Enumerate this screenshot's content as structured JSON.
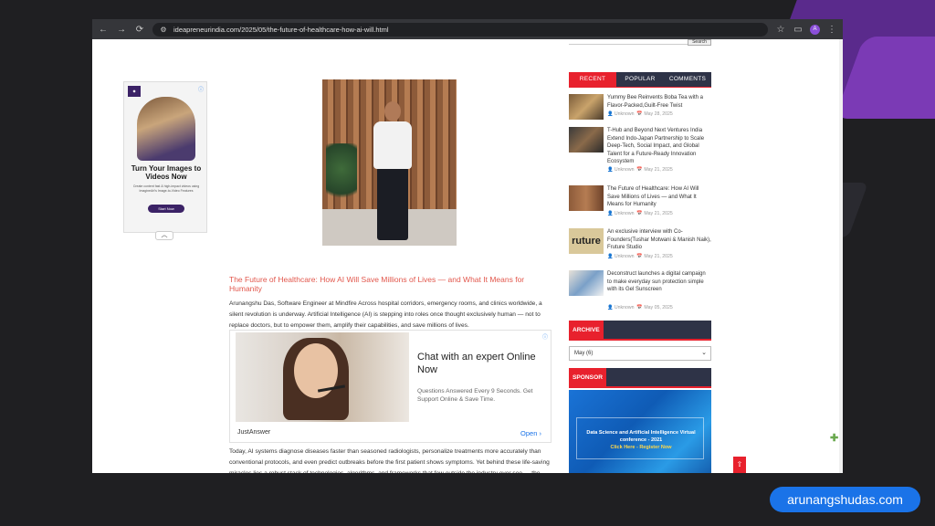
{
  "browser": {
    "url": "ideapreneurindia.com/2025/05/the-future-of-healthcare-how-ai-will.html",
    "profile_initial": "A"
  },
  "side_ad": {
    "headline": "Turn Your Images to Videos Now",
    "subtext": "Create content fast & high-impact videos using ImagineArt's Image-to-Video Features",
    "button": "Start Now"
  },
  "article": {
    "title": "The Future of Healthcare: How AI Will Save Millions of Lives — and What It Means for Humanity",
    "paragraph1": "Arunangshu Das, Software Engineer at Mindfire Across hospital corridors, emergency rooms, and clinics worldwide, a silent revolution is underway. Artificial Intelligence (AI) is stepping into roles once thought exclusively human — not to replace doctors, but to empower them, amplify their capabilities, and save millions of lives.",
    "paragraph2": "Today, AI systems diagnose diseases faster than seasoned radiologists, personalize treatments more accurately than conventional protocols, and even predict outbreaks before the first patient shows symptoms. Yet behind these life-saving miracles lies a robust stack of technologies, algorithms, and frameworks that few outside the industry ever see — the unsung heroes of a new medical era."
  },
  "inline_ad": {
    "headline": "Chat with an expert Online Now",
    "subtext": "Questions Answered Every 9 Seconds. Get Support Online & Save Time.",
    "brand": "JustAnswer",
    "cta": "Open"
  },
  "sidebar": {
    "search_button": "Search",
    "tabs": [
      "RECENT",
      "POPULAR",
      "COMMENTS"
    ],
    "posts": [
      {
        "title": "Yummy Bee Reinvents Boba Tea with a Flavor-Packed,Guilt-Free Twist",
        "author": "Unknown",
        "date": "May 28, 2025"
      },
      {
        "title": "T-Hub and Beyond Next Ventures India Extend Indo-Japan Partnership to Scale Deep-Tech, Social Impact, and Global Talent for a Future-Ready Innovation Ecosystem",
        "author": "Unknown",
        "date": "May 21, 2025"
      },
      {
        "title": "The Future of Healthcare: How AI Will Save Millions of Lives — and What It Means for Humanity",
        "author": "Unknown",
        "date": "May 21, 2025"
      },
      {
        "title": "An exclusive interview with Co-Founders(Tushar Motwani & Manish Naik), Fruture Studio",
        "author": "Unknown",
        "date": "May 21, 2025"
      },
      {
        "title": "Deconstruct launches a digital campaign to make everyday sun protection simple with its Gel Sunscreen",
        "author": "Unknown",
        "date": "May 05, 2025"
      }
    ],
    "archive_label": "ARCHIVE",
    "archive_value": "May (6)",
    "sponsor_label": "SPONSOR",
    "sponsor_text": "Data Science and Artificial Intelligence Virtual conference - 2021",
    "sponsor_cta": "Click Here - Register Now"
  },
  "thumb_text": "ruture",
  "brand_pill": "arunangshudas.com"
}
